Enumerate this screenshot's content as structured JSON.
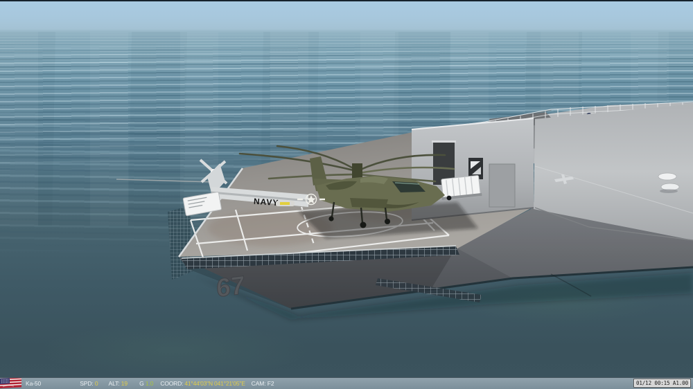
{
  "ship": {
    "hull_number": "67",
    "helicopter_tail_marking": "NAVY"
  },
  "statusbar": {
    "aircraft_label": "Ka-50",
    "spd_label": "SPD:",
    "spd_value": "0",
    "alt_label": "ALT:",
    "alt_value": "19",
    "g_label": "G",
    "g_value": "1.0",
    "coord_label": "COORD:",
    "coord_value": "41°44'03\"N 041°21'05\"E",
    "cam_label": "CAM:",
    "cam_value": "F2",
    "clock_value": "01/12 00:15 A1.00",
    "colors": {
      "bar_background": "#84969f",
      "label_text": "#eaeff2",
      "value_yellow": "#e0cc4a",
      "value_green": "#a8c43f",
      "clock_background": "#d6d6d6",
      "clock_text": "#1c1c1c"
    }
  },
  "icons": {
    "us_flag": "United States flag"
  },
  "scene_colors": {
    "sky": "#a9cbe3",
    "sea_deep": "#3a525c",
    "superstructure_gray": "#b4b7ba",
    "hull_gray": "#5c5f63",
    "deck_gray": "#8f8d8a",
    "helicopter_olive": "#666a4f",
    "navy_helicopter_gray": "#cfd3d5"
  }
}
